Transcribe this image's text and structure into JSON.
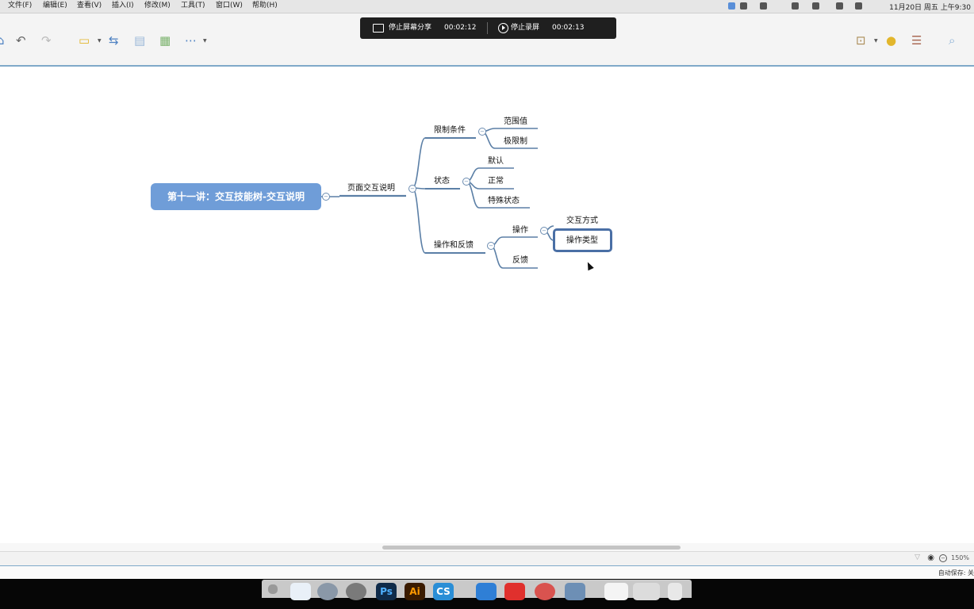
{
  "menubar": {
    "items": [
      "文件(F)",
      "编辑(E)",
      "查看(V)",
      "插入(I)",
      "修改(M)",
      "工具(T)",
      "窗口(W)",
      "帮助(H)"
    ],
    "clock": "11月20日 周五 上午9:30"
  },
  "recording": {
    "share_label": "停止屏幕分享",
    "share_time": "00:02:12",
    "record_label": "停止录屏",
    "record_time": "00:02:13"
  },
  "toolbar": {
    "icons": [
      "home-icon",
      "undo-icon",
      "redo-icon",
      "topic-icon",
      "relationship-icon",
      "boundary-icon",
      "summary-icon",
      "more-icon",
      "presentation-icon",
      "idea-icon",
      "gantt-icon",
      "search-icon"
    ]
  },
  "mindmap": {
    "root": "第十一讲：交互技能树-交互说明",
    "level1": "页面交互说明",
    "branches": [
      {
        "label": "限制条件",
        "children": [
          "范围值",
          "极限制"
        ]
      },
      {
        "label": "状态",
        "children": [
          "默认",
          "正常",
          "特殊状态"
        ]
      },
      {
        "label": "操作和反馈",
        "children": [
          "操作",
          "反馈"
        ]
      }
    ],
    "operation_children": [
      "交互方式",
      "操作类型"
    ],
    "selected": "操作类型"
  },
  "statusbar": {
    "zoom": "150%",
    "autosave": "自动保存: 关"
  },
  "dock": {
    "apps": [
      "finder-icon",
      "launchpad-icon",
      "system-preferences-icon",
      "Ps",
      "Ai",
      "CS",
      "vscode-icon",
      "xmind-icon",
      "chrome-icon",
      "preview-icon"
    ]
  },
  "colors": {
    "root_fill": "#6f9dd8",
    "branch_line": "#5b7fa6",
    "selected_border": "#4a6fa5",
    "accent": "#7fa9c9"
  }
}
